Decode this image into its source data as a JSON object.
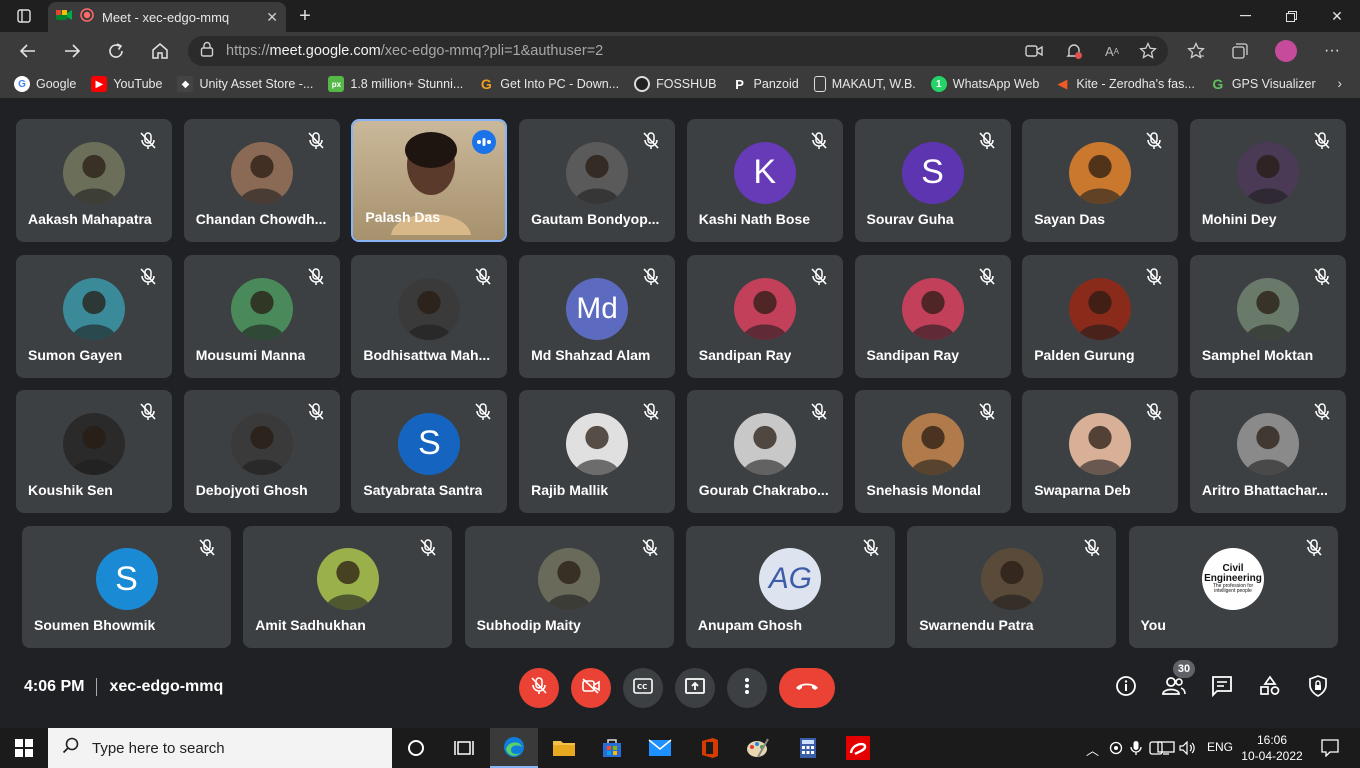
{
  "browser": {
    "tab_title": "Meet - xec-edgo-mmq",
    "url_scheme": "https://",
    "url_host": "meet.google.com",
    "url_path": "/xec-edgo-mmq?pli=1&authuser=2"
  },
  "bookmarks": [
    {
      "label": "Google",
      "color": "#4285f4",
      "glyph": "G"
    },
    {
      "label": "YouTube",
      "color": "#ff0000",
      "glyph": "▶"
    },
    {
      "label": "Unity Asset Store -...",
      "color": "#444444",
      "glyph": "◆"
    },
    {
      "label": "1.8 million+ Stunni...",
      "color": "#57b84a",
      "glyph": "px"
    },
    {
      "label": "Get Into PC - Down...",
      "color": "#d98c00",
      "glyph": "G"
    },
    {
      "label": "FOSSHUB",
      "color": "#222222",
      "glyph": "O"
    },
    {
      "label": "Panzoid",
      "color": "#111111",
      "glyph": "P"
    },
    {
      "label": "MAKAUT, W.B.",
      "color": "#3b3b3b",
      "glyph": "▢"
    },
    {
      "label": "WhatsApp Web",
      "color": "#25d366",
      "glyph": "1"
    },
    {
      "label": "Kite - Zerodha's fas...",
      "color": "#f15a24",
      "glyph": "◀"
    },
    {
      "label": "GPS Visualizer",
      "color": "#2e7d32",
      "glyph": "G"
    }
  ],
  "participants": [
    {
      "name": "Aakash Mahapatra",
      "initial": "",
      "color": "#6b6f5a"
    },
    {
      "name": "Chandan Chowdh...",
      "initial": "",
      "color": "#8a6a55"
    },
    {
      "name": "Palash Das",
      "initial": "",
      "color": "#b8a07a"
    },
    {
      "name": "Gautam Bondyop...",
      "initial": "",
      "color": "#5a5a5a"
    },
    {
      "name": "Kashi Nath Bose",
      "initial": "K",
      "color": "#673ab7"
    },
    {
      "name": "Sourav Guha",
      "initial": "S",
      "color": "#5e35b1"
    },
    {
      "name": "Sayan Das",
      "initial": "",
      "color": "#c9782d"
    },
    {
      "name": "Mohini Dey",
      "initial": "",
      "color": "#4a3a55"
    },
    {
      "name": "Sumon Gayen",
      "initial": "",
      "color": "#3a8a9a"
    },
    {
      "name": "Mousumi Manna",
      "initial": "",
      "color": "#4a8a5a"
    },
    {
      "name": "Bodhisattwa Mah...",
      "initial": "",
      "color": "#3a3a3a"
    },
    {
      "name": "Md Shahzad Alam",
      "initial": "Md",
      "color": "#5c6bc0"
    },
    {
      "name": "Sandipan Ray",
      "initial": "",
      "color": "#c2405a"
    },
    {
      "name": "Sandipan Ray",
      "initial": "",
      "color": "#c2405a"
    },
    {
      "name": "Palden Gurung",
      "initial": "",
      "color": "#8a2a1a"
    },
    {
      "name": "Samphel Moktan",
      "initial": "",
      "color": "#6a7a6a"
    },
    {
      "name": "Koushik Sen",
      "initial": "",
      "color": "#2a2a2a"
    },
    {
      "name": "Debojyoti Ghosh",
      "initial": "",
      "color": "#3a3a3a"
    },
    {
      "name": "Satyabrata Santra",
      "initial": "S",
      "color": "#1565c0"
    },
    {
      "name": "Rajib Mallik",
      "initial": "",
      "color": "#e0e0e0"
    },
    {
      "name": "Gourab Chakrabo...",
      "initial": "",
      "color": "#c8c8c8"
    },
    {
      "name": "Snehasis Mondal",
      "initial": "",
      "color": "#b07a4a"
    },
    {
      "name": "Swaparna Deb",
      "initial": "",
      "color": "#d8b098"
    },
    {
      "name": "Aritro Bhattachar...",
      "initial": "",
      "color": "#8a8a8a"
    },
    {
      "name": "Soumen Bhowmik",
      "initial": "S",
      "color": "#1a8ad4"
    },
    {
      "name": "Amit Sadhukhan",
      "initial": "",
      "color": "#9ab04a"
    },
    {
      "name": "Subhodip Maity",
      "initial": "",
      "color": "#6a6a5a"
    },
    {
      "name": "Anupam Ghosh",
      "initial": "AG",
      "color": "#dde4f0"
    },
    {
      "name": "Swarnendu Patra",
      "initial": "",
      "color": "#5a4a3a"
    },
    {
      "name": "You",
      "initial": "",
      "color": "#ffffff"
    }
  ],
  "you_logo": {
    "line1": "Civil",
    "line2": "Engineering",
    "line3": "The profession for intelligent people"
  },
  "bottom": {
    "time": "4:06 PM",
    "meeting_code": "xec-edgo-mmq",
    "participant_count": "30"
  },
  "taskbar": {
    "search_placeholder": "Type here to search",
    "language": "ENG",
    "clock_time": "16:06",
    "clock_date": "10-04-2022"
  },
  "colors": {
    "end_call": "#ea4335",
    "mic_off": "#ea4335",
    "accent": "#8ab4f8"
  }
}
